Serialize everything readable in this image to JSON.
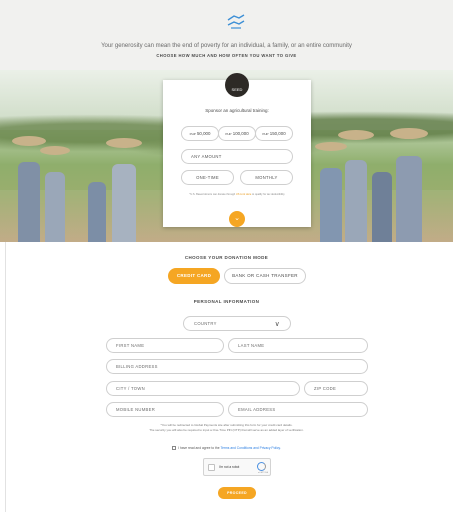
{
  "header": {
    "tagline": "Your generosity can mean the end of poverty for an individual, a family, or an entire community",
    "subheading": "CHOOSE HOW MUCH AND HOW OFTEN YOU WANT TO GIVE"
  },
  "donation_card": {
    "logo_text": "SEED",
    "title": "Sponsor an agricultural training:",
    "amounts": [
      {
        "currency": "PHP",
        "value": "50,000"
      },
      {
        "currency": "PHP",
        "value": "100,000"
      },
      {
        "currency": "PHP",
        "value": "150,000"
      }
    ],
    "any_amount_placeholder": "ANY AMOUNT",
    "frequency": [
      "ONE-TIME",
      "MONTHLY"
    ],
    "note_prefix": "*U.S. Based donors can donate through ",
    "note_link": "US Link Here",
    "note_suffix": " to qualify for tax deductibility"
  },
  "donation_mode": {
    "title": "CHOOSE YOUR DONATION MODE",
    "options": [
      "CREDIT CARD",
      "BANK OR CASH TRANSFER"
    ],
    "selected": "CREDIT CARD"
  },
  "personal_info": {
    "title": "PERSONAL INFORMATION",
    "country_placeholder": "COUNTRY",
    "first_name": "FIRST NAME",
    "last_name": "LAST NAME",
    "billing_address": "BILLING ADDRESS",
    "city_town": "CITY / TOWN",
    "zip_code": "ZIP CODE",
    "mobile_number": "MOBILE NUMBER",
    "email_address": "EMAIL ADDRESS"
  },
  "info_text_line1": "*You will be redirected to Global Payments site after submitting this form for your credit card details.",
  "info_text_line2": "The security you will also be required to input a One-Time PIN (OTP) that will serve as an added layer of verification.",
  "agreement": {
    "prefix": "I have read and agree to the ",
    "link": "Terms and Conditions and Privacy Policy."
  },
  "captcha": {
    "label": "I'm not a robot",
    "brand": "reCAPTCHA"
  },
  "proceed_label": "PROCEED",
  "colors": {
    "accent": "#f5a623",
    "link": "#2a7de1",
    "border": "#cfcfcf"
  }
}
